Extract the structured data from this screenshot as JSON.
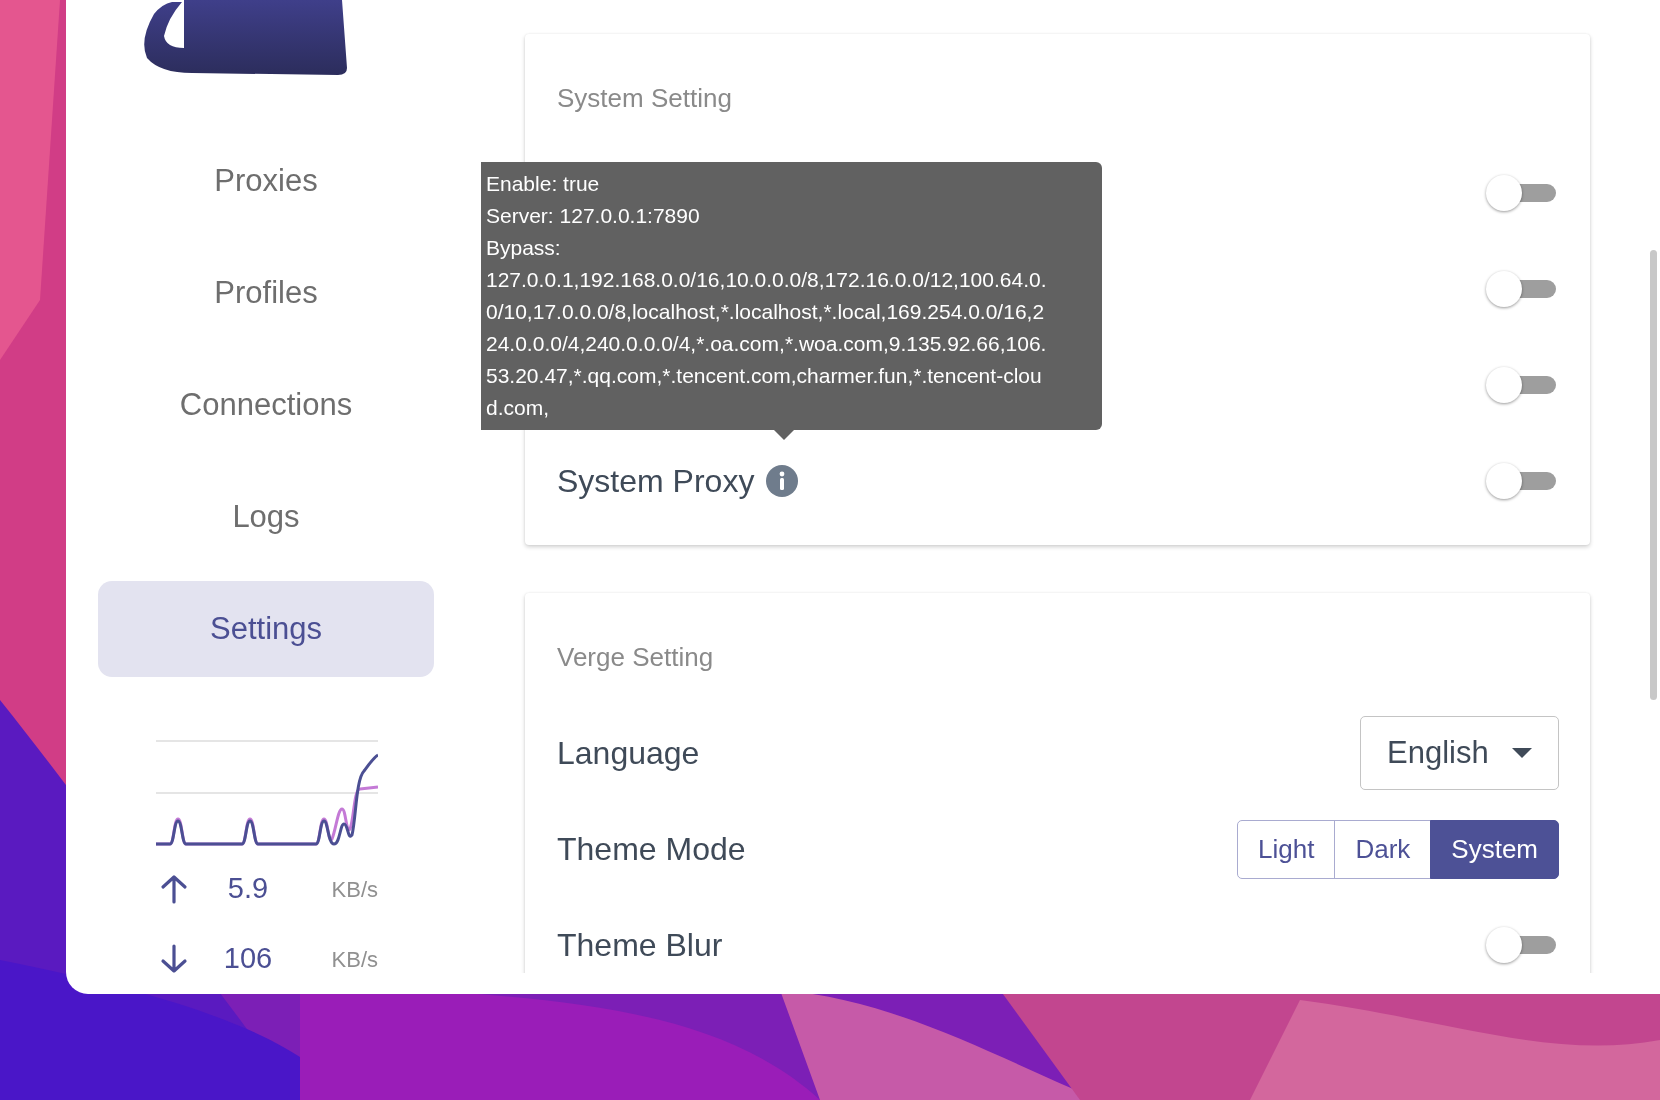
{
  "sidebar": {
    "items": [
      {
        "label": "Proxies",
        "selected": false
      },
      {
        "label": "Profiles",
        "selected": false
      },
      {
        "label": "Connections",
        "selected": false
      },
      {
        "label": "Logs",
        "selected": false
      },
      {
        "label": "Settings",
        "selected": true
      }
    ]
  },
  "traffic": {
    "up": {
      "value": "5.9",
      "unit": "KB/s"
    },
    "down": {
      "value": "106",
      "unit": "KB/s"
    }
  },
  "system_setting": {
    "title": "System Setting",
    "rows": [
      {
        "on": false
      },
      {
        "on": false
      },
      {
        "on": false
      },
      {
        "label": "System Proxy",
        "info": true,
        "on": false
      }
    ],
    "tooltip": {
      "lines": [
        "Enable: true",
        "Server: 127.0.0.1:7890",
        "Bypass:",
        "127.0.0.1,192.168.0.0/16,10.0.0.0/8,172.16.0.0/12,100.64.0.0/10,17.0.0.0/8,localhost,*.localhost,*.local,169.254.0.0/16,224.0.0.0/4,240.0.0.0/4,*.oa.com,*.woa.com,9.135.92.66,106.53.20.47,*.qq.com,*.tencent.com,charmer.fun,*.tencent-cloud.com,"
      ]
    }
  },
  "verge_setting": {
    "title": "Verge Setting",
    "rows": [
      {
        "kind": "select",
        "label": "Language",
        "value": "English"
      },
      {
        "kind": "segmented",
        "label": "Theme Mode",
        "options": [
          {
            "label": "Light",
            "selected": false
          },
          {
            "label": "Dark",
            "selected": false
          },
          {
            "label": "System",
            "selected": true
          }
        ]
      },
      {
        "kind": "switch",
        "label": "Theme Blur",
        "on": false
      }
    ]
  }
}
